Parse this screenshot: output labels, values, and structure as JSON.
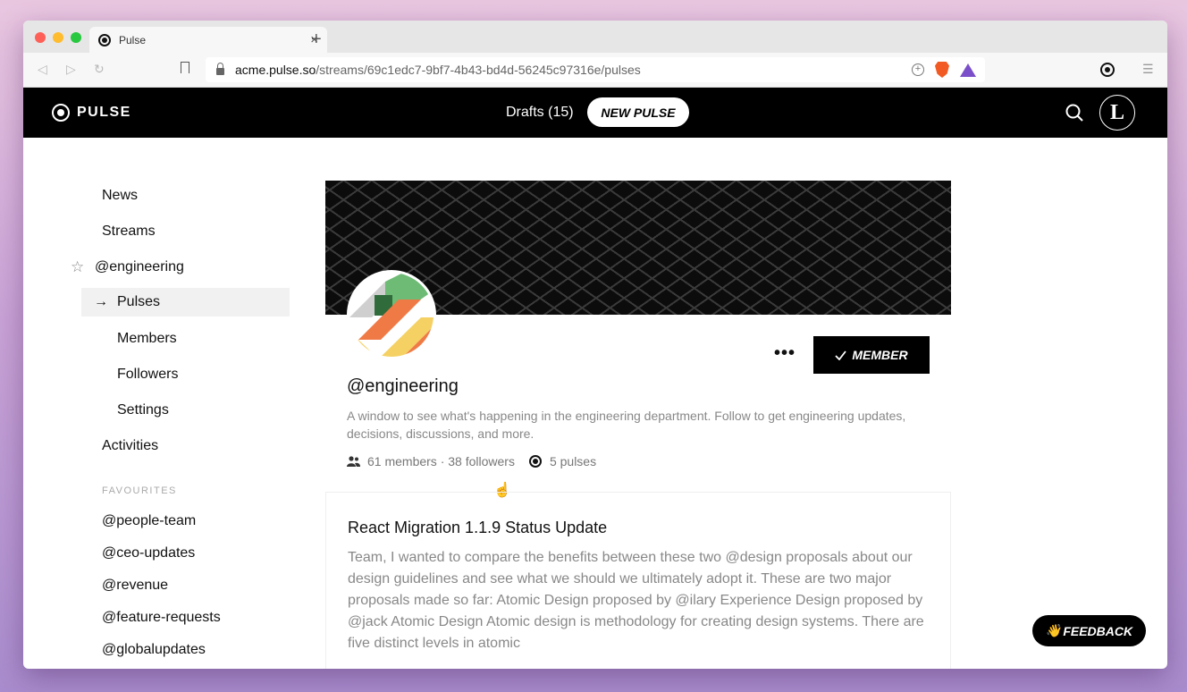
{
  "browser": {
    "tab_title": "Pulse",
    "tab_close": "×",
    "new_tab": "+",
    "url_host": "acme.pulse.so",
    "url_path": "/streams/69c1edc7-9bf7-4b43-bd4d-56245c97316e/pulses"
  },
  "header": {
    "logo_text": "PULSE",
    "drafts_label": "Drafts (15)",
    "new_pulse_label": "NEW PULSE",
    "avatar_initial": "L"
  },
  "sidebar": {
    "news": "News",
    "streams": "Streams",
    "stream_name": "@engineering",
    "pulses": "Pulses",
    "members": "Members",
    "followers": "Followers",
    "settings": "Settings",
    "activities": "Activities",
    "favourites_label": "FAVOURITES",
    "favourites": [
      "@people-team",
      "@ceo-updates",
      "@revenue",
      "@feature-requests",
      "@globalupdates"
    ]
  },
  "stream": {
    "name": "@engineering",
    "description": "A window to see what's happening in the engineering department. Follow to get engineering updates, decisions, discussions, and more.",
    "members_followers": "61 members · 38 followers",
    "pulses_count": "5 pulses",
    "member_label": "MEMBER",
    "more_label": "•••"
  },
  "pulse_card": {
    "title": "React Migration 1.1.9 Status Update",
    "body": "Team, I wanted to compare the benefits between these two @design proposals about our design guidelines and see what we should we ultimately adopt it. These are two major proposals made so far: Atomic Design proposed by @ilary Experience Design proposed by @jack Atomic Design Atomic design is methodology for creating design systems. There are five distinct levels in atomic"
  },
  "feedback": {
    "emoji": "👋",
    "label": "FEEDBACK"
  },
  "colors": {
    "header_bg": "#000000",
    "active_item_bg": "#f1f1f1",
    "muted_text": "#888888"
  }
}
